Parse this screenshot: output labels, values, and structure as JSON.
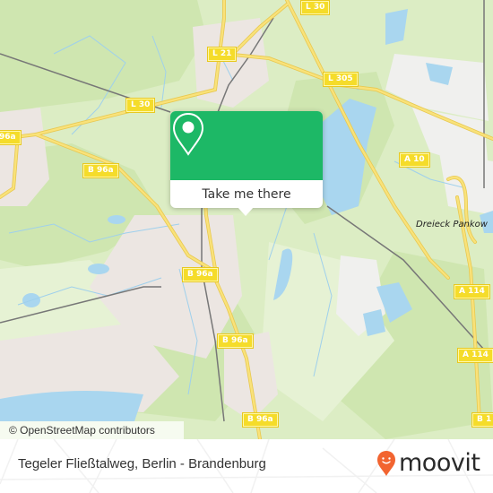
{
  "map": {
    "road_labels": [
      {
        "id": "l30-top",
        "text": "L 30"
      },
      {
        "id": "l21",
        "text": "L 21"
      },
      {
        "id": "l305",
        "text": "L 305"
      },
      {
        "id": "l30-left",
        "text": "L 30"
      },
      {
        "id": "b96a-left-edge",
        "text": "96a"
      },
      {
        "id": "b96a-1",
        "text": "B 96a"
      },
      {
        "id": "a10",
        "text": "A 10"
      },
      {
        "id": "b96a-2",
        "text": "B 96a"
      },
      {
        "id": "a114-1",
        "text": "A 114"
      },
      {
        "id": "b96a-3",
        "text": "B 96a"
      },
      {
        "id": "a114-2",
        "text": "A 114"
      },
      {
        "id": "b96a-4",
        "text": "B 96a"
      },
      {
        "id": "b1-edge",
        "text": "B 1"
      }
    ],
    "place_labels": [
      {
        "id": "dreieck-pankow",
        "text": "Dreieck Pankow"
      }
    ],
    "attribution": "© OpenStreetMap contributors",
    "colors": {
      "forest": "#cfe6b0",
      "meadow": "#e2f0cc",
      "water": "#a9d6ef",
      "urban": "#ece6e2",
      "road": "#f7dc5c",
      "rail": "#777777"
    }
  },
  "popup": {
    "icon": "map-pin-icon",
    "button_label": "Take me there",
    "accent": "#1db866"
  },
  "footer": {
    "location_title": "Tegeler Fließtalweg, Berlin - Brandenburg",
    "brand_name": "moovit",
    "brand_color": "#f26430"
  }
}
